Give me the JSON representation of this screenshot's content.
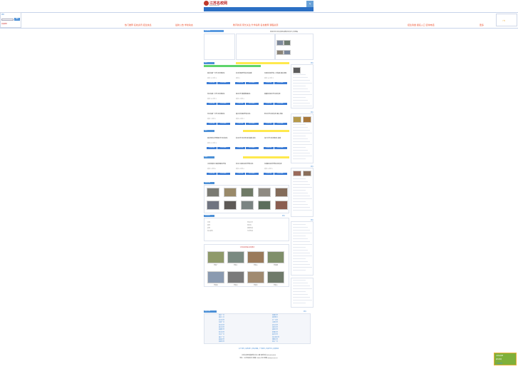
{
  "site": {
    "name": "江苏名校网",
    "subtitle": "www.jsmxw.net",
    "top_button": "Q"
  },
  "left_banner": {
    "label": "搜索",
    "button": "搜索",
    "link": "高级搜索"
  },
  "right_banner": {
    "label": "广告"
  },
  "scroll_texts": [
    "热门推荐 名校资讯 招生信息",
    "最新公告 学校动态",
    "教育新闻 家长关注 升学指导 名校推荐 课程资源",
    "招生简章 报名入口 咨询电话",
    "更多"
  ],
  "section_tabs": [
    "名校推荐",
    "热点"
  ],
  "notice": "欢迎访问江苏名校网 最新招生信息 点击查看",
  "school_sections": [
    {
      "title": "初中",
      "more": "更多"
    },
    {
      "title": "高中",
      "more": "更多"
    },
    {
      "title": "职校",
      "more": "更多"
    },
    {
      "title": "校园风采",
      "more": ""
    },
    {
      "title": "考试信息",
      "more": "更多"
    }
  ],
  "card_buttons": {
    "a": "学校详情",
    "b": "招生简章 ›"
  },
  "cards": [
    {
      "title": "南京市第一中学 初中部招生",
      "meta": "浏览 12 评论 3"
    },
    {
      "title": "苏州外国语学校 招生简章",
      "meta": "浏览 8"
    },
    {
      "title": "无锡市实验学校 入学指南 报名须知",
      "meta": "浏览 10 评论 2"
    },
    {
      "title": "常州市第二中学 初中部招生",
      "meta": "浏览 15 评论 1"
    },
    {
      "title": "扬州中学 教育集团招生",
      "meta": "浏览 9 评论 0"
    },
    {
      "title": "南通市实验中学 招生信息",
      "meta": ""
    },
    {
      "title": "徐州市第一中学 初中部招生",
      "meta": "浏览 7 评论 1"
    },
    {
      "title": "镇江市外国语学校 招生",
      "meta": "浏览 6 评论 2"
    },
    {
      "title": "泰州中学 招生信息 报名 须知",
      "meta": ""
    },
    {
      "title": "南京师范大学附属中学 高中招生",
      "meta": "浏览 22 评论 5"
    },
    {
      "title": "苏州中学 高中部 招生简章 发布",
      "meta": ""
    },
    {
      "title": "海门中学 高中部招生 简章",
      "meta": ""
    },
    {
      "title": "江苏省南京工程高等职业学校",
      "meta": "浏览 5 评论 0"
    },
    {
      "title": "苏州工业职业技术学院 招生",
      "meta": "浏览 4 评论 0"
    },
    {
      "title": "无锡职业技术学院 招生信息",
      "meta": "浏览 3 评论 1"
    }
  ],
  "campus_gallery_title": "江苏名校风采 名校展示",
  "gallery_captions": [
    "学校一",
    "学校二",
    "学校三",
    "学校四",
    "学校五",
    "学校六",
    "学校七",
    "学校八"
  ],
  "exam_links": [
    "中考",
    "高考",
    "会考",
    "自主招生",
    "学业水平",
    "特长生",
    "体育考试",
    "艺术考试"
  ],
  "list_section": {
    "title": "名校导航",
    "more": "更多"
  },
  "school_list_left": [
    "南京一中",
    "南京二中",
    "苏州中学",
    "无锡一中",
    "常州中学",
    "扬州中学",
    "南通中学",
    "泰州中学",
    "徐州一中",
    "镇江一中",
    "盐城中学",
    "淮阴中学"
  ],
  "school_list_right": [
    "金陵中学",
    "南师附中",
    "天一中学",
    "江阴中学",
    "启东中学",
    "海安中学",
    "如皋中学",
    "姜堰中学",
    "宿迁中学",
    "连云港中学",
    "溧阳中学",
    "宜兴一中"
  ],
  "side_blocks": [
    {
      "title": "更多"
    },
    {
      "title": "更多"
    },
    {
      "title": "更多"
    },
    {
      "title": "更多"
    }
  ],
  "footer": {
    "links": "关于我们 | 联系我们 | 网站地图 | 广告服务 | 免责声明 | 友情链接",
    "line1": "江苏名校网 版权所有 苏ICP备 联系电话 400-000-0000",
    "line2": "地址：江苏省南京市 邮编 210000 电子邮箱 info@jsmxw.net"
  },
  "float_ad": {
    "line1": "江苏名校网",
    "line2": "招生咨询",
    "line3": "立即咨询"
  }
}
